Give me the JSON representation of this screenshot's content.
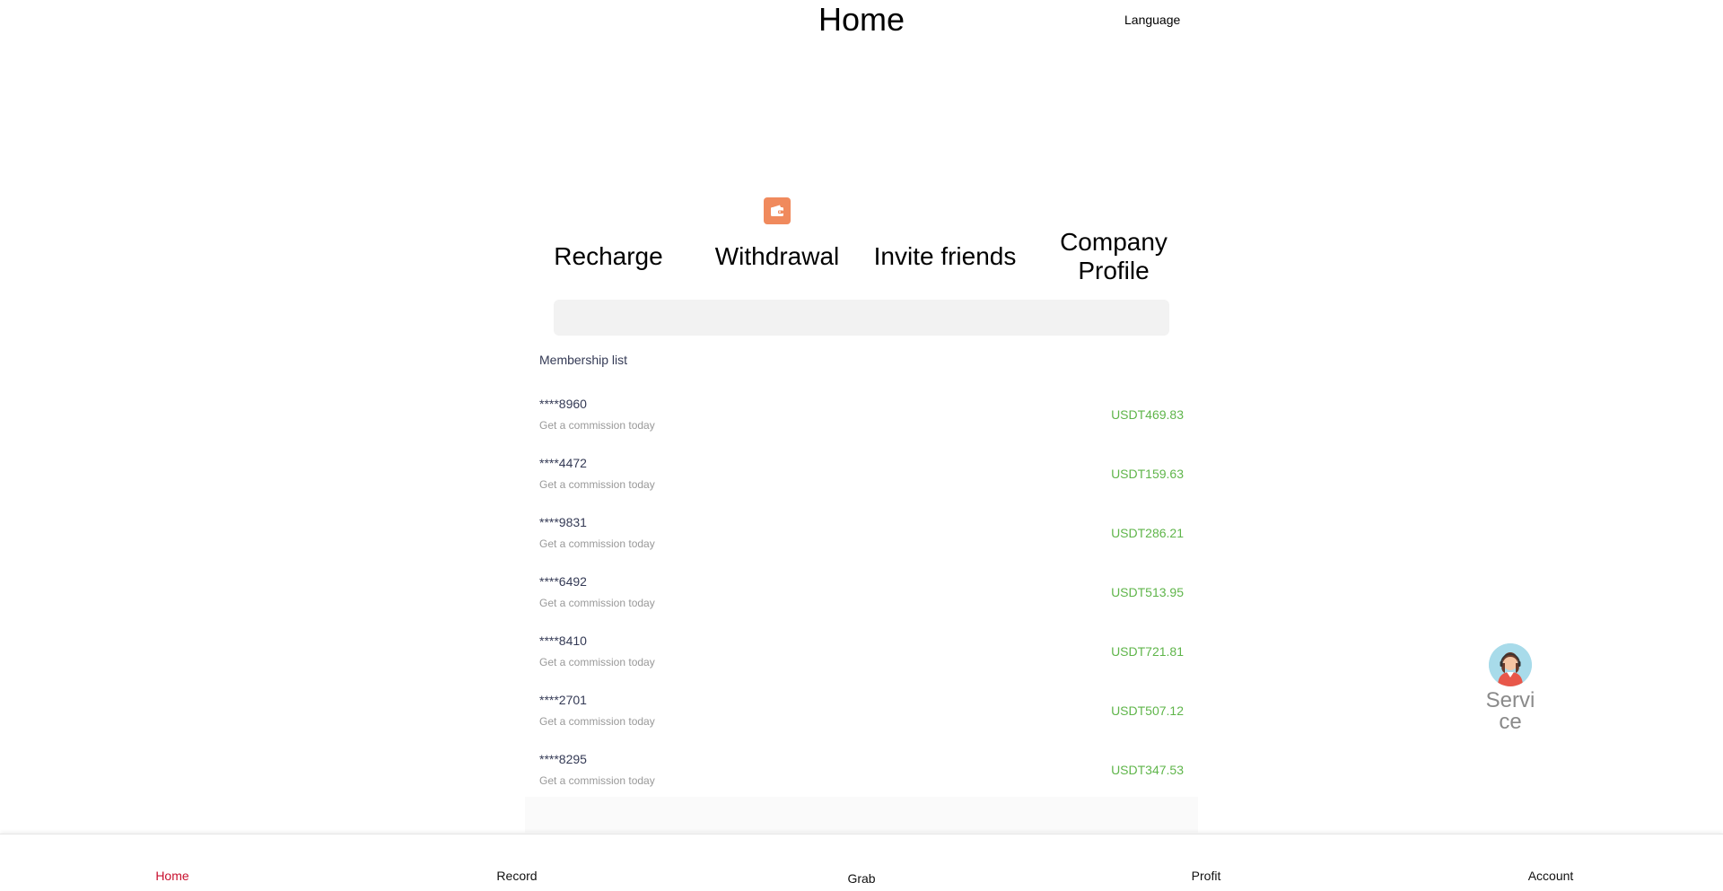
{
  "header": {
    "title": "Home",
    "language_label": "Language"
  },
  "actions": {
    "icon": "wallet-icon",
    "icon_color": "#f08a5d",
    "items": [
      {
        "label": "Recharge"
      },
      {
        "label": "Withdrawal"
      },
      {
        "label": "Invite friends"
      },
      {
        "label": "Company Profile"
      }
    ]
  },
  "membership": {
    "title": "Membership list",
    "rows": [
      {
        "name": "****8960",
        "desc": "Get a commission today",
        "amount": "USDT469.83"
      },
      {
        "name": "****4472",
        "desc": "Get a commission today",
        "amount": "USDT159.63"
      },
      {
        "name": "****9831",
        "desc": "Get a commission today",
        "amount": "USDT286.21"
      },
      {
        "name": "****6492",
        "desc": "Get a commission today",
        "amount": "USDT513.95"
      },
      {
        "name": "****8410",
        "desc": "Get a commission today",
        "amount": "USDT721.81"
      },
      {
        "name": "****2701",
        "desc": "Get a commission today",
        "amount": "USDT507.12"
      },
      {
        "name": "****8295",
        "desc": "Get a commission today",
        "amount": "USDT347.53"
      }
    ],
    "amount_color": "#5fb54a"
  },
  "service": {
    "label": "Service",
    "icon": "customer-service-avatar-icon"
  },
  "tabbar": {
    "active_color": "#c8102e",
    "items": [
      {
        "label": "Home",
        "active": true
      },
      {
        "label": "Record",
        "active": false
      },
      {
        "label": "Grab",
        "active": false
      },
      {
        "label": "Profit",
        "active": false
      },
      {
        "label": "Account",
        "active": false
      }
    ]
  }
}
